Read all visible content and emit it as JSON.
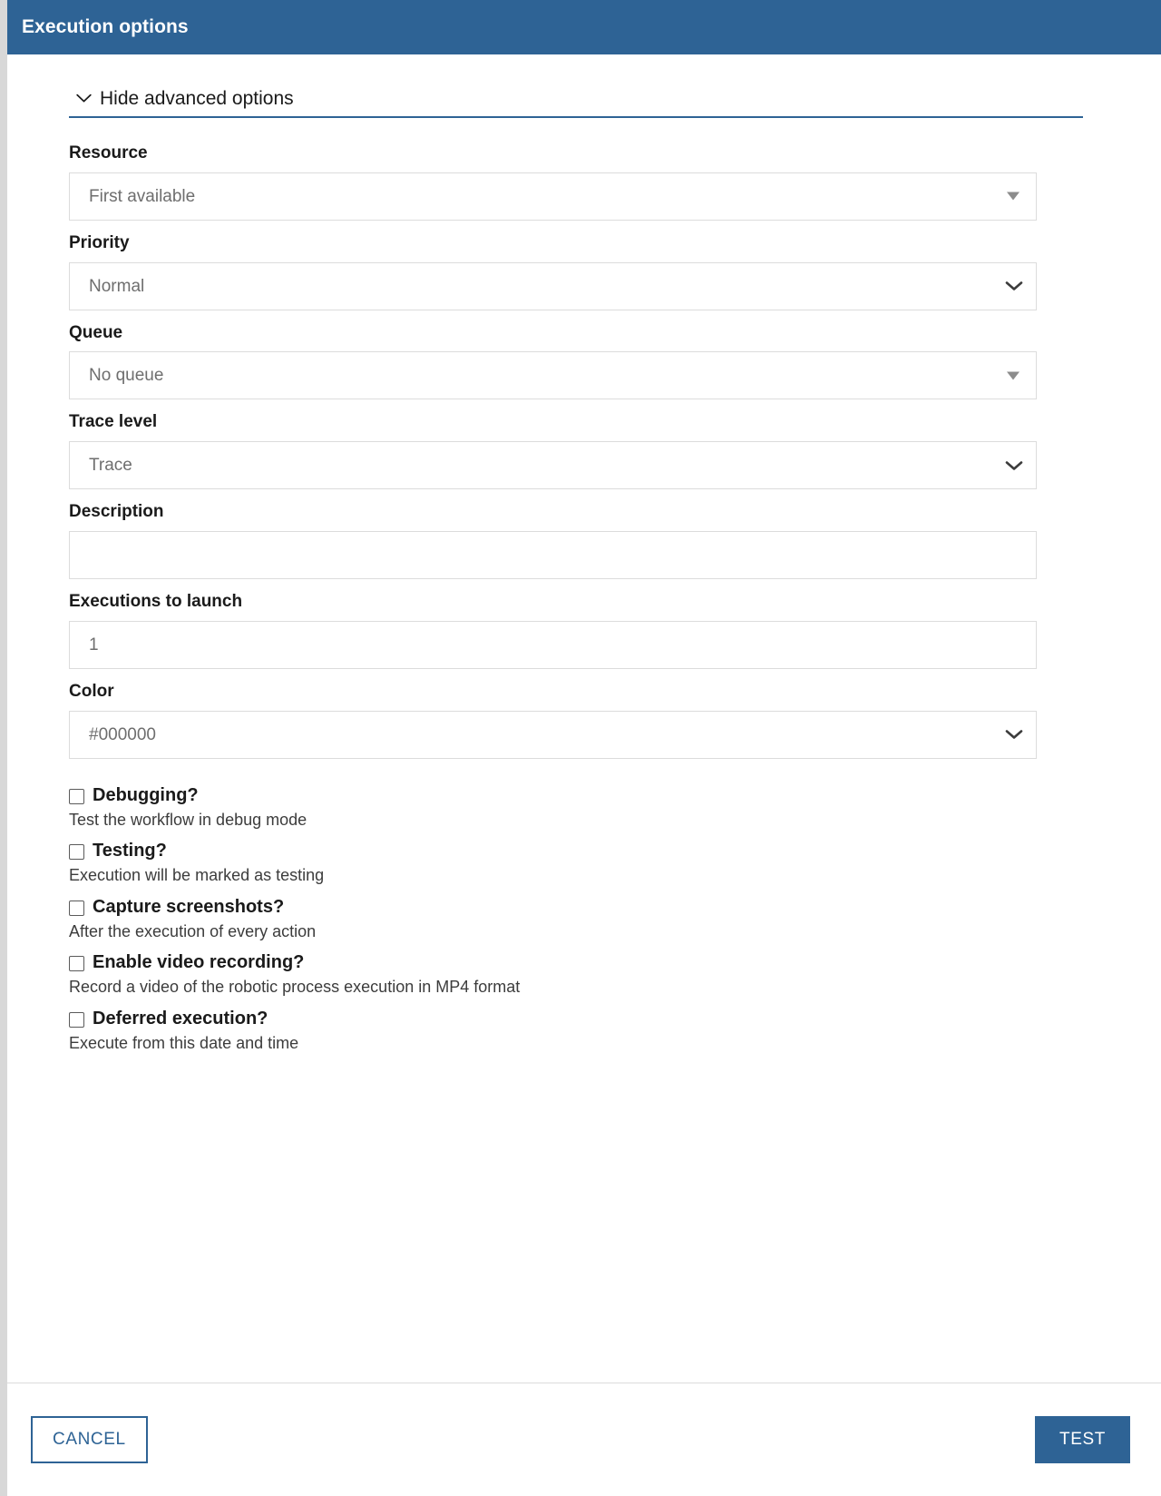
{
  "header": {
    "title": "Execution options",
    "background_color": "#2e6395",
    "text_color": "#ffffff"
  },
  "advanced": {
    "toggle_label": "Hide advanced options",
    "toggle_icon": "chevron-down-icon",
    "underline_color": "#2e6395"
  },
  "fields": [
    {
      "label": "Resource",
      "value": "First available",
      "control": "dropdown",
      "arrow": "triangle-down-icon"
    },
    {
      "label": "Priority",
      "value": "Normal",
      "control": "select",
      "arrow": "chevron-down-icon"
    },
    {
      "label": "Queue",
      "value": "No queue",
      "control": "dropdown",
      "arrow": "triangle-down-icon"
    },
    {
      "label": "Trace level",
      "value": "Trace",
      "control": "select",
      "arrow": "chevron-down-icon"
    },
    {
      "label": "Description",
      "value": "",
      "control": "text",
      "arrow": "none"
    },
    {
      "label": "Executions to launch",
      "value": "1",
      "control": "number",
      "arrow": "none"
    },
    {
      "label": "Color",
      "value": "#000000",
      "control": "select",
      "arrow": "chevron-down-icon"
    }
  ],
  "checkboxes": [
    {
      "label": "Debugging?",
      "description": "Test the workflow in debug mode",
      "checked": false
    },
    {
      "label": "Testing?",
      "description": "Execution will be marked as testing",
      "checked": false
    },
    {
      "label": "Capture screenshots?",
      "description": "After the execution of every action",
      "checked": false
    },
    {
      "label": "Enable video recording?",
      "description": "Record a video of the robotic process execution in MP4 format",
      "checked": false
    },
    {
      "label": "Deferred execution?",
      "description": "Execute from this date and time",
      "checked": false
    }
  ],
  "footer": {
    "cancel_label": "CANCEL",
    "submit_label": "TEST",
    "accent_color": "#2e6395"
  }
}
